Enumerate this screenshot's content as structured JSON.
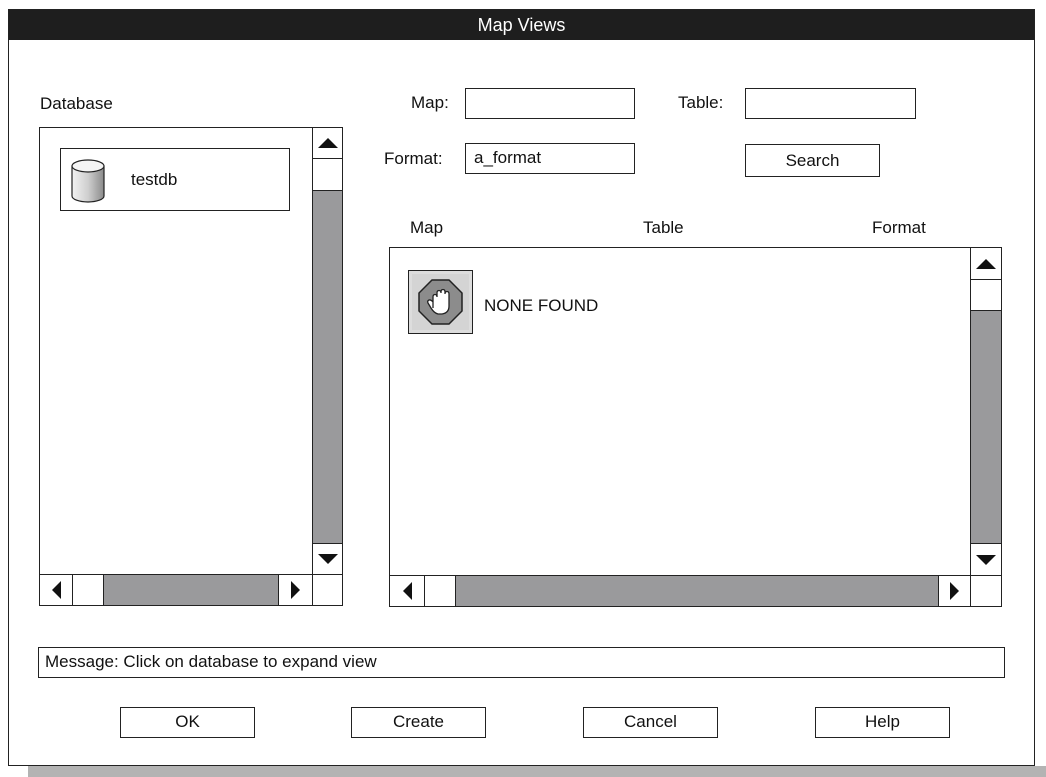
{
  "window": {
    "title": "Map Views"
  },
  "database_panel": {
    "label": "Database",
    "items": [
      {
        "name": "testdb",
        "icon": "database-cylinder-icon"
      }
    ]
  },
  "search": {
    "map_label": "Map:",
    "map_value": "",
    "table_label": "Table:",
    "table_value": "",
    "format_label": "Format:",
    "format_value": "a_format",
    "search_button": "Search"
  },
  "results": {
    "columns": [
      "Map",
      "Table",
      "Format"
    ],
    "empty_icon": "stop-hand-icon",
    "empty_text": "NONE FOUND"
  },
  "message": {
    "text": "Message:  Click on database to expand view"
  },
  "buttons": {
    "ok": "OK",
    "create": "Create",
    "cancel": "Cancel",
    "help": "Help"
  },
  "colors": {
    "titlebar": "#1e1e1e",
    "scroll_track": "#9a9a9c",
    "stop_icon": "#8c8c8c"
  }
}
